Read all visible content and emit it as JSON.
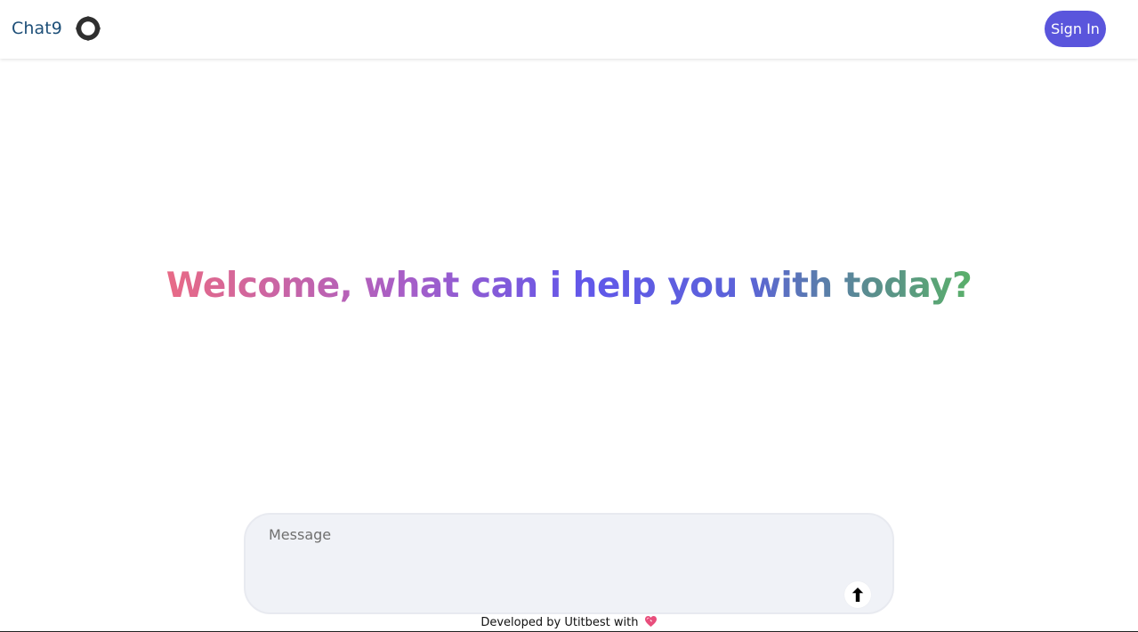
{
  "header": {
    "brand_name": "Chat9",
    "brand_icon": "chat9-logo-icon",
    "sign_in_label": "Sign In",
    "accent_color": "#5a55dc"
  },
  "main": {
    "welcome_text": "Welcome, what can i help you with today?"
  },
  "composer": {
    "placeholder": "Message",
    "value": "",
    "send_icon": "arrow-up-icon"
  },
  "footer": {
    "text": "Developed by Utitbest with",
    "heart_icon": "heart-icon"
  }
}
